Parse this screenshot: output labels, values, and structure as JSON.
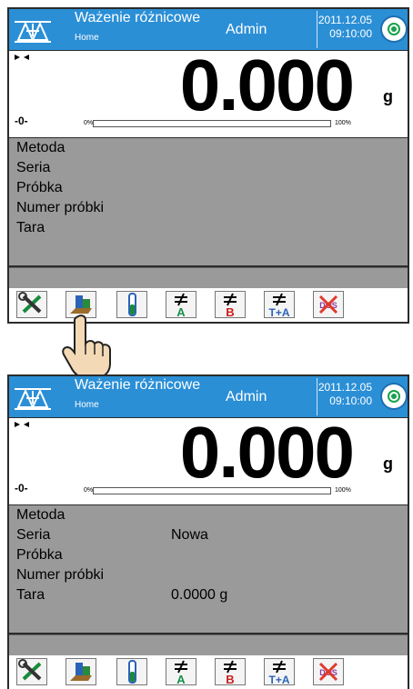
{
  "screens": [
    {
      "header": {
        "title": "Ważenie różnicowe",
        "subtitle": "Home",
        "user": "Admin",
        "date": "2011.12.05",
        "time": "09:10:00"
      },
      "weighing": {
        "value": "0.000",
        "unit": "g",
        "zero_indicator": "-0-",
        "range_min": "0%",
        "range_max": "100%",
        "load_fraction": 0
      },
      "info": [
        {
          "label": "Metoda",
          "value": ""
        },
        {
          "label": "Seria",
          "value": ""
        },
        {
          "label": "Próbka",
          "value": ""
        },
        {
          "label": "Numer próbki",
          "value": ""
        },
        {
          "label": "Tara",
          "value": ""
        }
      ]
    },
    {
      "header": {
        "title": "Ważenie różnicowe",
        "subtitle": "Home",
        "user": "Admin",
        "date": "2011.12.05",
        "time": "09:10:00"
      },
      "weighing": {
        "value": "0.000",
        "unit": "g",
        "zero_indicator": "-0-",
        "range_min": "0%",
        "range_max": "100%",
        "load_fraction": 0
      },
      "info": [
        {
          "label": "Metoda",
          "value": ""
        },
        {
          "label": "Seria",
          "value": "Nowa"
        },
        {
          "label": "Próbka",
          "value": ""
        },
        {
          "label": "Numer próbki",
          "value": ""
        },
        {
          "label": "Tara",
          "value": "0.0000 g"
        }
      ]
    }
  ],
  "toolbar_icons": [
    "tools-icon",
    "sample-container-icon",
    "test-tube-icon",
    "tare-a-icon",
    "tare-b-icon",
    "tare-plus-a-icon",
    "dos-disabled-icon"
  ],
  "toolbar_labels": {
    "a": "A",
    "b": "B",
    "ta": "T+A",
    "dos": "DOS"
  },
  "colors": {
    "header": "#2b8fd6",
    "info_bg": "#9a9a9a",
    "status_green": "#17a24b"
  }
}
